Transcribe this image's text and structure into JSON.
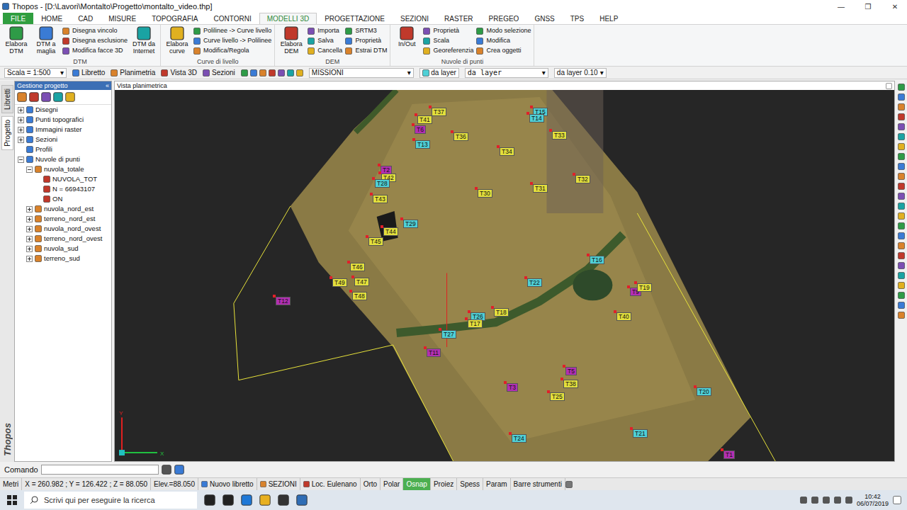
{
  "window": {
    "title": "Thopos - [D:\\Lavori\\Montalto\\Progetto\\montalto_video.thp]",
    "controls": [
      "—",
      "❐",
      "✕"
    ]
  },
  "menu_tabs": [
    {
      "label": "FILE",
      "selected": false,
      "kind": "file"
    },
    {
      "label": "HOME",
      "selected": false,
      "kind": "tab"
    },
    {
      "label": "CAD",
      "selected": false,
      "kind": "tab"
    },
    {
      "label": "MISURE",
      "selected": false,
      "kind": "tab"
    },
    {
      "label": "TOPOGRAFIA",
      "selected": false,
      "kind": "tab"
    },
    {
      "label": "CONTORNI",
      "selected": false,
      "kind": "tab"
    },
    {
      "label": "MODELLI 3D",
      "selected": true,
      "kind": "tab"
    },
    {
      "label": "PROGETTAZIONE",
      "selected": false,
      "kind": "tab"
    },
    {
      "label": "SEZIONI",
      "selected": false,
      "kind": "tab"
    },
    {
      "label": "RASTER",
      "selected": false,
      "kind": "tab"
    },
    {
      "label": "PREGEO",
      "selected": false,
      "kind": "tab"
    },
    {
      "label": "GNSS",
      "selected": false,
      "kind": "tab"
    },
    {
      "label": "TPS",
      "selected": false,
      "kind": "tab"
    },
    {
      "label": "HELP",
      "selected": false,
      "kind": "tab"
    }
  ],
  "ribbon": [
    {
      "label": "DTM",
      "items": [
        {
          "label": "Elabora DTM",
          "kind": "large"
        },
        {
          "label": "DTM a maglia",
          "kind": "large"
        },
        {
          "label": "Disegna vincolo",
          "kind": "small"
        },
        {
          "label": "Disegna esclusione",
          "kind": "small"
        },
        {
          "label": "Modifica facce 3D",
          "kind": "small"
        },
        {
          "label": "DTM da Internet",
          "kind": "large"
        }
      ]
    },
    {
      "label": "Curve di livello",
      "items": [
        {
          "label": "Elabora curve",
          "kind": "large"
        },
        {
          "label": "Polilinee -> Curve livello",
          "kind": "small"
        },
        {
          "label": "Curve livello -> Polilinee",
          "kind": "small"
        },
        {
          "label": "Modifica/Regola",
          "kind": "small"
        }
      ]
    },
    {
      "label": "DEM",
      "items": [
        {
          "label": "Elabora DEM",
          "kind": "large"
        },
        {
          "label": "Importa",
          "kind": "small"
        },
        {
          "label": "Salva",
          "kind": "small"
        },
        {
          "label": "Cancella",
          "kind": "small"
        },
        {
          "label": "SRTM3",
          "kind": "small"
        },
        {
          "label": "Proprietà",
          "kind": "small"
        },
        {
          "label": "Estrai DTM",
          "kind": "small"
        }
      ]
    },
    {
      "label": "Nuvole di punti",
      "items": [
        {
          "label": "In/Out",
          "kind": "large"
        },
        {
          "label": "Proprietà",
          "kind": "small"
        },
        {
          "label": "Scala",
          "kind": "small"
        },
        {
          "label": "Georeferenzia",
          "kind": "small"
        },
        {
          "label": "Modo selezione",
          "kind": "small"
        },
        {
          "label": "Modifica",
          "kind": "small"
        },
        {
          "label": "Crea oggetti",
          "kind": "small"
        }
      ]
    }
  ],
  "toolbar": {
    "scale": "Scala = 1:500",
    "views": [
      "Libretto",
      "Planimetria",
      "Vista 3D",
      "Sezioni"
    ],
    "layer": "MISSIONI",
    "color": "da layer",
    "linetype": "da layer",
    "thickness": "da layer 0.10"
  },
  "side_tabs": [
    {
      "label": "Libretti",
      "selected": false
    },
    {
      "label": "Progetto",
      "selected": true
    }
  ],
  "brand": "Thopos",
  "project_panel": {
    "title": "Gestione progetto",
    "close": "«",
    "tree": [
      {
        "label": "Disegni",
        "level": 0,
        "expanded": false
      },
      {
        "label": "Punti topografici",
        "level": 0,
        "expanded": false
      },
      {
        "label": "Immagini raster",
        "level": 0,
        "expanded": false
      },
      {
        "label": "Sezioni",
        "level": 0,
        "expanded": false
      },
      {
        "label": "Profili",
        "level": 0
      },
      {
        "label": "Nuvole di punti",
        "level": 0,
        "expanded": true
      },
      {
        "label": "nuvola_totale",
        "level": 1,
        "expanded": true
      },
      {
        "label": "NUVOLA_TOT",
        "level": 2
      },
      {
        "label": "N = 66943107",
        "level": 2
      },
      {
        "label": "ON",
        "level": 2
      },
      {
        "label": "nuvola_nord_est",
        "level": 1,
        "expanded": false
      },
      {
        "label": "terreno_nord_est",
        "level": 1,
        "expanded": false
      },
      {
        "label": "nuvola_nord_ovest",
        "level": 1,
        "expanded": false
      },
      {
        "label": "terreno_nord_ovest",
        "level": 1,
        "expanded": false
      },
      {
        "label": "nuvola_sud",
        "level": 1,
        "expanded": false
      },
      {
        "label": "terreno_sud",
        "level": 1,
        "expanded": false
      }
    ]
  },
  "view": {
    "title": "Vista planimetrica",
    "axes": {
      "x": "X",
      "y": "Y"
    },
    "pins": [
      {
        "label": "T37",
        "color": "#e3df3c"
      },
      {
        "label": "T41",
        "color": "#e3df3c"
      },
      {
        "label": "T6",
        "color": "#b32fb3"
      },
      {
        "label": "T13",
        "color": "#4fd0d6"
      },
      {
        "label": "T36",
        "color": "#e3df3c"
      },
      {
        "label": "T15",
        "color": "#4fd0d6"
      },
      {
        "label": "T14",
        "color": "#4fd0d6"
      },
      {
        "label": "T33",
        "color": "#e3df3c"
      },
      {
        "label": "T34",
        "color": "#e3df3c"
      },
      {
        "label": "T32",
        "color": "#e3df3c"
      },
      {
        "label": "T31",
        "color": "#e3df3c"
      },
      {
        "label": "T30",
        "color": "#e3df3c"
      },
      {
        "label": "T2",
        "color": "#b32fb3"
      },
      {
        "label": "T42",
        "color": "#e3df3c"
      },
      {
        "label": "T28",
        "color": "#4fd0d6"
      },
      {
        "label": "T43",
        "color": "#e3df3c"
      },
      {
        "label": "T29",
        "color": "#4fd0d6"
      },
      {
        "label": "T44",
        "color": "#e3df3c"
      },
      {
        "label": "T45",
        "color": "#e3df3c"
      },
      {
        "label": "T16",
        "color": "#4fd0d6"
      },
      {
        "label": "T46",
        "color": "#e3df3c"
      },
      {
        "label": "T47",
        "color": "#e3df3c"
      },
      {
        "label": "T49",
        "color": "#e3df3c"
      },
      {
        "label": "T48",
        "color": "#e3df3c"
      },
      {
        "label": "T12",
        "color": "#b32fb3"
      },
      {
        "label": "T22",
        "color": "#4fd0d6"
      },
      {
        "label": "T9",
        "color": "#b32fb3"
      },
      {
        "label": "T19",
        "color": "#e3df3c"
      },
      {
        "label": "T40",
        "color": "#e3df3c"
      },
      {
        "label": "T26",
        "color": "#4fd0d6"
      },
      {
        "label": "T18",
        "color": "#e3df3c"
      },
      {
        "label": "T17",
        "color": "#e3df3c"
      },
      {
        "label": "T27",
        "color": "#4fd0d6"
      },
      {
        "label": "T11",
        "color": "#b32fb3"
      },
      {
        "label": "T5",
        "color": "#b32fb3"
      },
      {
        "label": "T38",
        "color": "#e3df3c"
      },
      {
        "label": "T3",
        "color": "#b32fb3"
      },
      {
        "label": "T25",
        "color": "#e3df3c"
      },
      {
        "label": "T20",
        "color": "#4fd0d6"
      },
      {
        "label": "T24",
        "color": "#4fd0d6"
      },
      {
        "label": "T21",
        "color": "#4fd0d6"
      },
      {
        "label": "T1",
        "color": "#b32fb3"
      }
    ]
  },
  "command": {
    "label": "Comando",
    "value": ""
  },
  "status_bar": {
    "unit": "Metri",
    "coords": "X = 260.982 ; Y = 126.422 ; Z = 88.050",
    "elev": "Elev.=88.050",
    "items": [
      "Nuovo libretto",
      "SEZIONI",
      "Loc. Eulenano"
    ],
    "toggles": [
      {
        "label": "Orto",
        "on": false
      },
      {
        "label": "Polar",
        "on": false
      },
      {
        "label": "Osnap",
        "on": true
      },
      {
        "label": "Proiez",
        "on": false
      },
      {
        "label": "Spess",
        "on": false
      },
      {
        "label": "Param",
        "on": false
      },
      {
        "label": "Barre strumenti",
        "on": false
      }
    ]
  },
  "taskbar": {
    "search": "Scrivi qui per eseguire la ricerca",
    "time": "10:42",
    "date": "06/07/2019"
  }
}
